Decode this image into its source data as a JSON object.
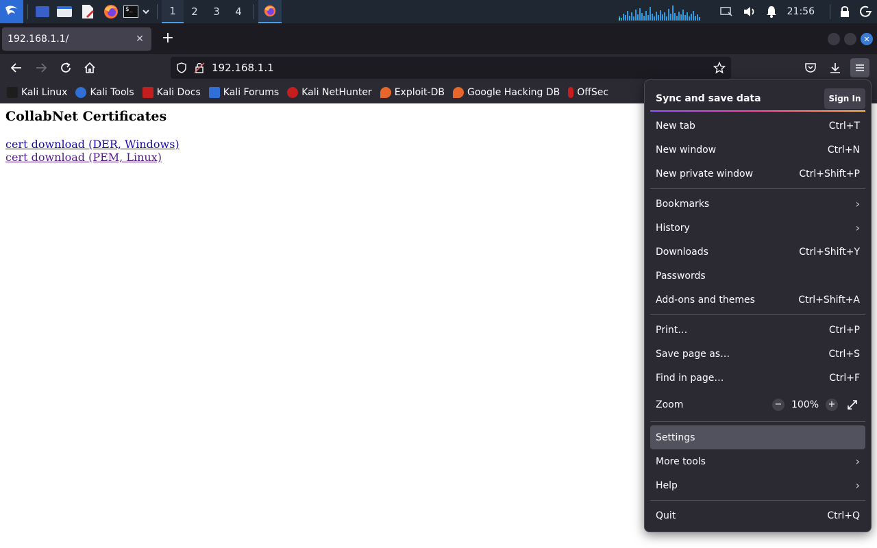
{
  "taskbar": {
    "workspaces": [
      "1",
      "2",
      "3",
      "4"
    ],
    "active_workspace": "1",
    "clock": "21:56",
    "icons": [
      "kali-menu-icon",
      "show-desktop-icon",
      "file-manager-icon",
      "text-editor-icon",
      "firefox-icon",
      "terminal-icon",
      "chevron-down-icon"
    ]
  },
  "browser": {
    "tab_title": "192.168.1.1/",
    "url": "192.168.1.1"
  },
  "bookmarks": [
    {
      "label": "Kali Linux",
      "color": "#1d1d1d"
    },
    {
      "label": "Kali Tools",
      "color": "#2f6fd6"
    },
    {
      "label": "Kali Docs",
      "color": "#c41e1e"
    },
    {
      "label": "Kali Forums",
      "color": "#2f6fd6"
    },
    {
      "label": "Kali NetHunter",
      "color": "#c41e1e"
    },
    {
      "label": "Exploit-DB",
      "color": "#e8662a"
    },
    {
      "label": "Google Hacking DB",
      "color": "#e8662a"
    },
    {
      "label": "OffSec",
      "color": "#c41e1e"
    }
  ],
  "page": {
    "heading": "CollabNet Certificates",
    "links": [
      {
        "label": "cert download (DER, Windows)"
      },
      {
        "label": "cert download (PEM, Linux)"
      }
    ]
  },
  "appmenu": {
    "sync_title": "Sync and save data",
    "sign_in": "Sign In",
    "items": [
      {
        "label": "New tab",
        "shortcut": "Ctrl+T"
      },
      {
        "label": "New window",
        "shortcut": "Ctrl+N"
      },
      {
        "label": "New private window",
        "shortcut": "Ctrl+Shift+P"
      },
      {
        "label": "Bookmarks",
        "shortcut": ""
      },
      {
        "label": "History",
        "shortcut": ""
      },
      {
        "label": "Downloads",
        "shortcut": "Ctrl+Shift+Y"
      },
      {
        "label": "Passwords",
        "shortcut": ""
      },
      {
        "label": "Add-ons and themes",
        "shortcut": "Ctrl+Shift+A"
      },
      {
        "label": "Print…",
        "shortcut": "Ctrl+P"
      },
      {
        "label": "Save page as…",
        "shortcut": "Ctrl+S"
      },
      {
        "label": "Find in page…",
        "shortcut": "Ctrl+F"
      },
      {
        "label": "Zoom",
        "shortcut": ""
      },
      {
        "label": "Settings",
        "shortcut": ""
      },
      {
        "label": "More tools",
        "shortcut": ""
      },
      {
        "label": "Help",
        "shortcut": ""
      },
      {
        "label": "Quit",
        "shortcut": "Ctrl+Q"
      }
    ],
    "zoom": {
      "minus": "−",
      "value": "100%",
      "plus": "+"
    }
  },
  "colors": {
    "taskbar_bg": "#1f2733",
    "toolbar_bg": "#2b2a33",
    "accent": "#3a7bd5",
    "link": "#1a0dab",
    "link_visited": "#551a8b"
  }
}
